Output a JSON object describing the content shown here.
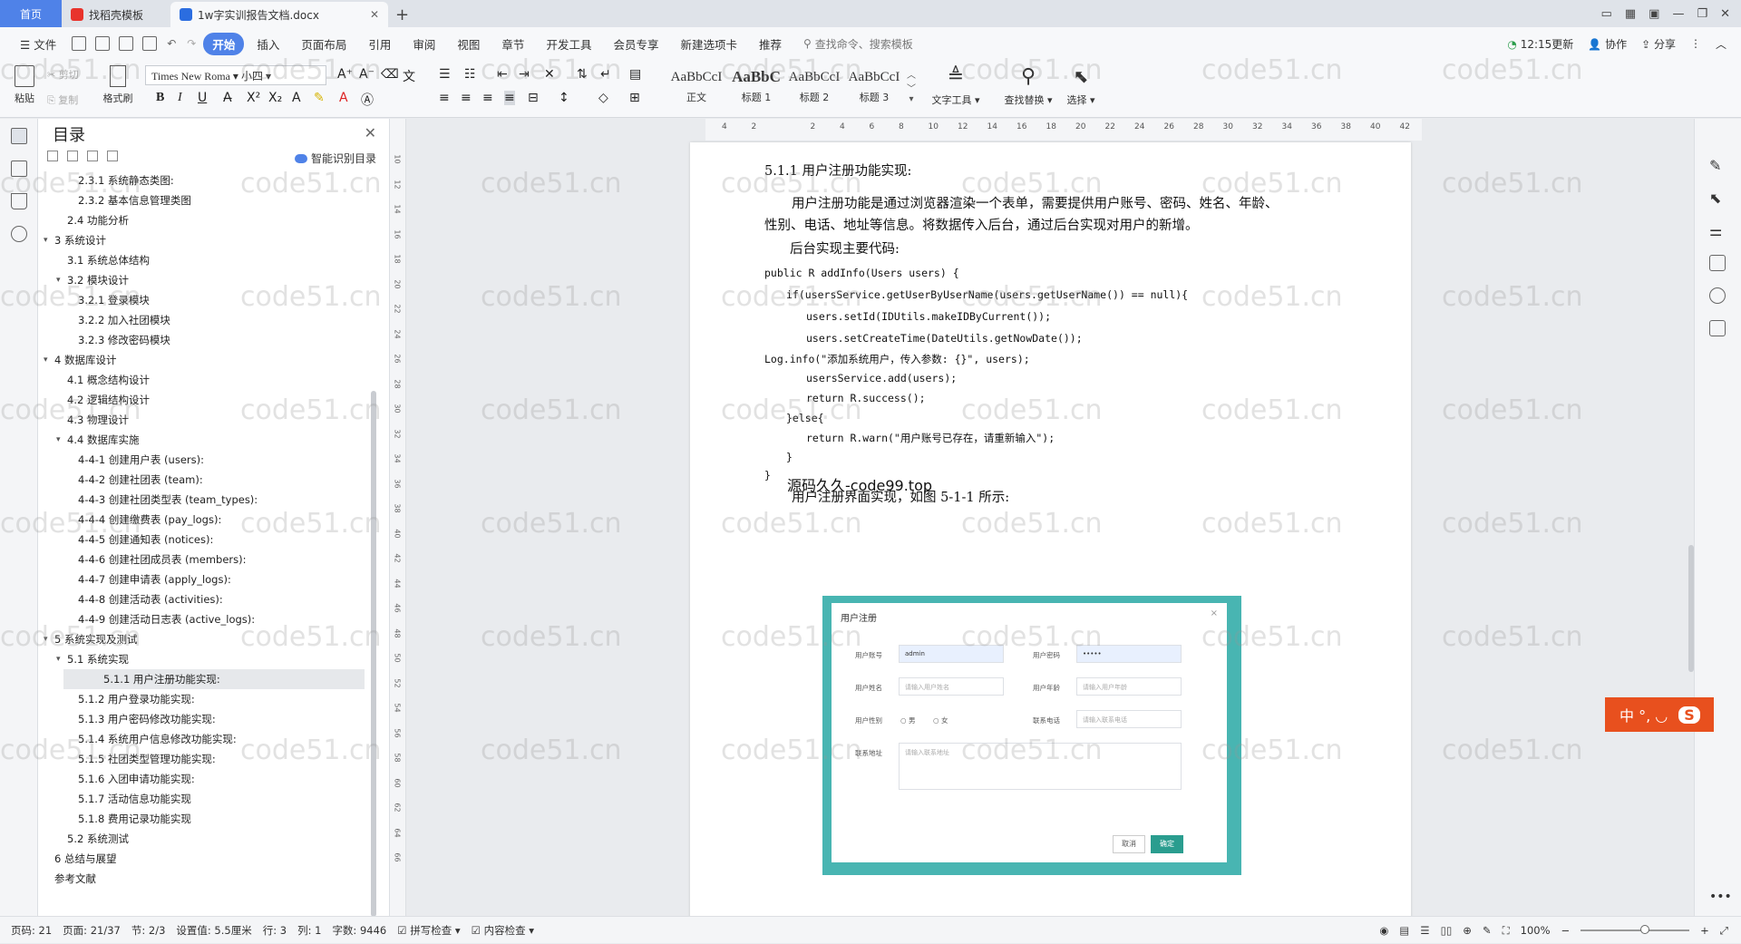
{
  "tabs": [
    {
      "label": "首页"
    },
    {
      "label": "找稻壳模板"
    },
    {
      "label": "1w字实训报告文档.docx"
    }
  ],
  "menu": [
    "文件",
    "开始",
    "插入",
    "页面布局",
    "引用",
    "审阅",
    "视图",
    "章节",
    "开发工具",
    "会员专享",
    "新建选项卡",
    "推荐"
  ],
  "search_cmd": "查找命令、搜索模板",
  "right_menu": {
    "update": "12:15更新",
    "collab": "协作",
    "share": "分享"
  },
  "ribbon": {
    "paste": "粘贴",
    "cut": "剪切",
    "copy": "复制",
    "format_painter": "格式刷",
    "font_name": "Times New Roma",
    "font_size": "小四",
    "styles": [
      {
        "sample": "AaBbCcI",
        "label": "正文"
      },
      {
        "sample": "AaBbC",
        "label": "标题 1"
      },
      {
        "sample": "AaBbCcI",
        "label": "标题 2"
      },
      {
        "sample": "AaBbCcI",
        "label": "标题 3"
      }
    ],
    "text_tools": "文字工具",
    "find_replace": "查找替换",
    "select": "选择"
  },
  "toc": {
    "title": "目录",
    "smart": "智能识别目录",
    "items": [
      {
        "text": "2.3.1 系统静态类图:",
        "level": 3,
        "arrow": ""
      },
      {
        "text": "2.3.2 基本信息管理类图",
        "level": 3,
        "arrow": ""
      },
      {
        "text": "2.4 功能分析",
        "level": 2,
        "arrow": ""
      },
      {
        "text": "3 系统设计",
        "level": 1,
        "arrow": "v"
      },
      {
        "text": "3.1 系统总体结构",
        "level": 2,
        "arrow": ""
      },
      {
        "text": "3.2 模块设计",
        "level": 2,
        "arrow": "v"
      },
      {
        "text": "3.2.1 登录模块",
        "level": 3,
        "arrow": ""
      },
      {
        "text": "3.2.2 加入社团模块",
        "level": 3,
        "arrow": ""
      },
      {
        "text": "3.2.3 修改密码模块",
        "level": 3,
        "arrow": ""
      },
      {
        "text": "4 数据库设计",
        "level": 1,
        "arrow": "v"
      },
      {
        "text": "4.1 概念结构设计",
        "level": 2,
        "arrow": ""
      },
      {
        "text": "4.2 逻辑结构设计",
        "level": 2,
        "arrow": ""
      },
      {
        "text": "4.3 物理设计",
        "level": 2,
        "arrow": ""
      },
      {
        "text": "4.4 数据库实施",
        "level": 2,
        "arrow": "v"
      },
      {
        "text": "4-4-1 创建用户表 (users):",
        "level": 3,
        "arrow": ""
      },
      {
        "text": "4-4-2 创建社团表 (team):",
        "level": 3,
        "arrow": ""
      },
      {
        "text": "4-4-3 创建社团类型表 (team_types):",
        "level": 3,
        "arrow": ""
      },
      {
        "text": "4-4-4 创建缴费表 (pay_logs):",
        "level": 3,
        "arrow": ""
      },
      {
        "text": "4-4-5 创建通知表 (notices):",
        "level": 3,
        "arrow": ""
      },
      {
        "text": "4-4-6 创建社团成员表 (members):",
        "level": 3,
        "arrow": ""
      },
      {
        "text": "4-4-7 创建申请表 (apply_logs):",
        "level": 3,
        "arrow": ""
      },
      {
        "text": "4-4-8 创建活动表 (activities):",
        "level": 3,
        "arrow": ""
      },
      {
        "text": "4-4-9 创建活动日志表 (active_logs):",
        "level": 3,
        "arrow": ""
      },
      {
        "text": "5 系统实现及测试",
        "level": 1,
        "arrow": "v"
      },
      {
        "text": "5.1 系统实现",
        "level": 2,
        "arrow": "v"
      },
      {
        "text": "5.1.1 用户注册功能实现:",
        "level": 3,
        "arrow": "",
        "selected": true
      },
      {
        "text": "5.1.2 用户登录功能实现:",
        "level": 3,
        "arrow": ""
      },
      {
        "text": "5.1.3 用户密码修改功能实现:",
        "level": 3,
        "arrow": ""
      },
      {
        "text": "5.1.4 系统用户信息修改功能实现:",
        "level": 3,
        "arrow": ""
      },
      {
        "text": "5.1.5 社团类型管理功能实现:",
        "level": 3,
        "arrow": ""
      },
      {
        "text": "5.1.6 入团申请功能实现:",
        "level": 3,
        "arrow": ""
      },
      {
        "text": "5.1.7 活动信息功能实现",
        "level": 3,
        "arrow": ""
      },
      {
        "text": "5.1.8 费用记录功能实现",
        "level": 3,
        "arrow": ""
      },
      {
        "text": "5.2 系统测试",
        "level": 2,
        "arrow": ""
      },
      {
        "text": "6 总结与展望",
        "level": 1,
        "arrow": ""
      },
      {
        "text": "参考文献",
        "level": 1,
        "arrow": ""
      }
    ]
  },
  "doc": {
    "heading": "5.1.1 用户注册功能实现:",
    "para1a": "用户注册功能是通过浏览器渲染一个表单，需要提供用户账号、密码、姓名、年龄、",
    "para1b": "性别、电话、地址等信息。将数据传入后台，通过后台实现对用户的新增。",
    "para2": "后台实现主要代码:",
    "code": [
      {
        "text": "public R addInfo(Users users) {",
        "indent": 0
      },
      {
        "text": "if(usersService.getUserByUserName(users.getUserName()) == null){",
        "indent": 1
      },
      {
        "text": "users.setId(IDUtils.makeIDByCurrent());",
        "indent": 2
      },
      {
        "text": "users.setCreateTime(DateUtils.getNowDate());",
        "indent": 2
      },
      {
        "text": "Log.info(\"添加系统用户，传入参数: {}\", users);",
        "indent": 0
      },
      {
        "text": "usersService.add(users);",
        "indent": 2
      },
      {
        "text": "return R.success();",
        "indent": 2
      },
      {
        "text": "}else{",
        "indent": 1
      },
      {
        "text": "return R.warn(\"用户账号已存在，请重新输入\");",
        "indent": 2
      },
      {
        "text": "}",
        "indent": 1
      },
      {
        "text": "}",
        "indent": 0
      }
    ],
    "overlay": "源码久久-code99.top",
    "para3": "用户注册界面实现，如图 5-1-1 所示:",
    "dialog": {
      "title": "用户注册",
      "close": "×",
      "account_label": "用户账号",
      "account_value": "admin",
      "password_label": "用户密码",
      "password_value": "•••••",
      "name_label": "用户姓名",
      "name_placeholder": "请输入用户姓名",
      "age_label": "用户年龄",
      "age_placeholder": "请输入用户年龄",
      "gender_label": "用户性别",
      "male": "男",
      "female": "女",
      "phone_label": "联系电话",
      "phone_placeholder": "请输入联系电话",
      "address_label": "联系地址",
      "address_placeholder": "请输入联系地址",
      "cancel": "取消",
      "ok": "确定"
    }
  },
  "ruler_top": [
    "4",
    "2",
    "",
    "2",
    "4",
    "6",
    "8",
    "10",
    "12",
    "14",
    "16",
    "18",
    "20",
    "22",
    "24",
    "26",
    "28",
    "30",
    "32",
    "34",
    "36",
    "38",
    "40",
    "42"
  ],
  "ruler_left": [
    "10",
    "12",
    "14",
    "16",
    "18",
    "20",
    "22",
    "24",
    "26",
    "28",
    "30",
    "32",
    "34",
    "36",
    "38",
    "40",
    "42",
    "44",
    "46",
    "48",
    "50",
    "52",
    "54",
    "56",
    "58",
    "60",
    "62",
    "64",
    "66"
  ],
  "ime": "中 °, ◡",
  "status": {
    "page_num": "页码: 21",
    "pages": "页面: 21/37",
    "section": "节: 2/3",
    "setting": "设置值: 5.5厘米",
    "row": "行: 3",
    "col": "列: 1",
    "words": "字数: 9446",
    "spell": "拼写检查",
    "content": "内容检查",
    "zoom": "100%"
  },
  "watermark": "code51.cn",
  "colors": {
    "accent": "#4f82e8",
    "teal": "#48b5b2",
    "ime": "#e8501e"
  }
}
